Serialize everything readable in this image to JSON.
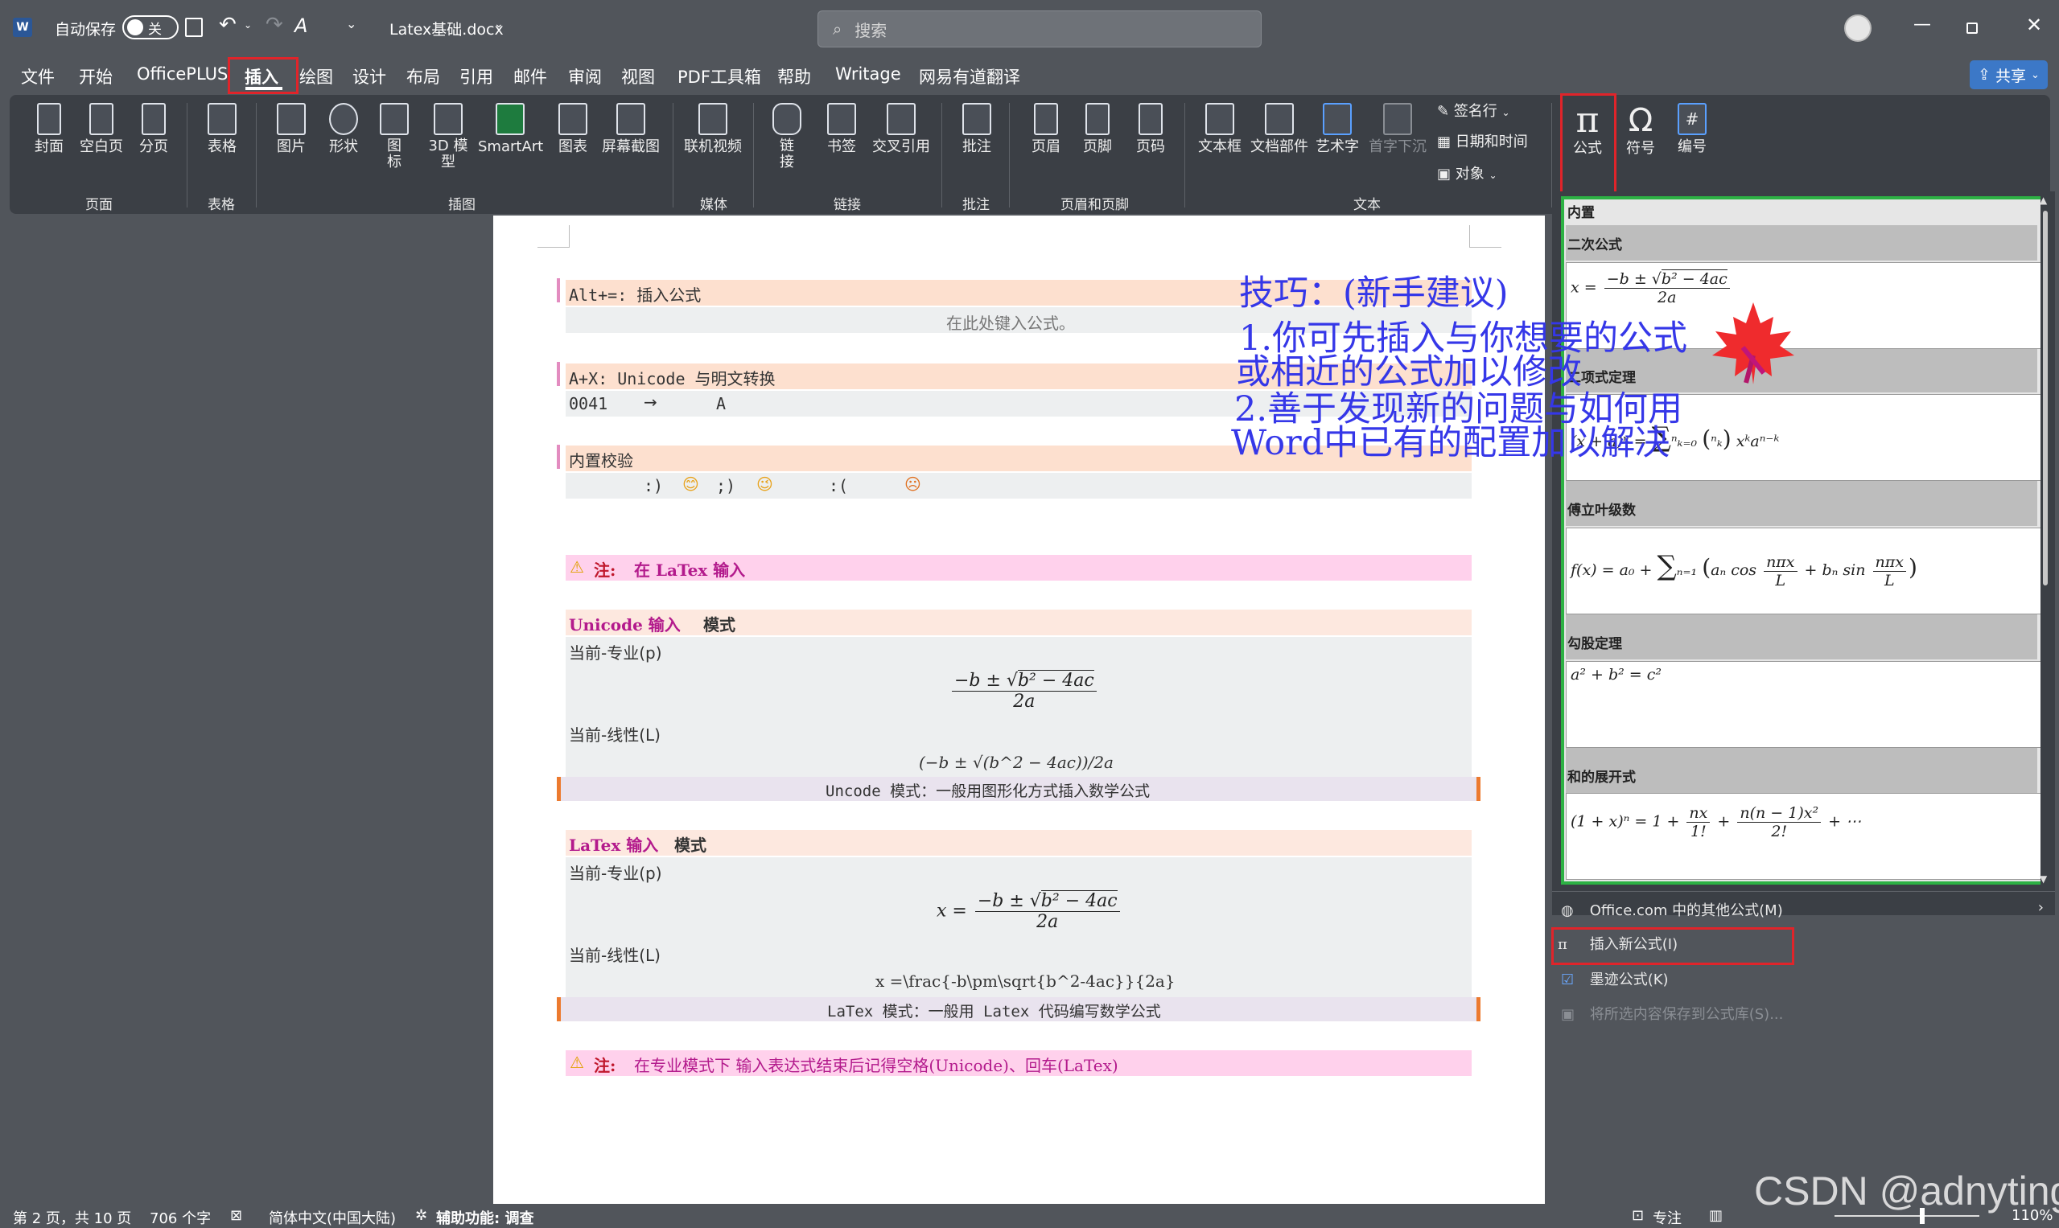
{
  "titlebar": {
    "autosave_label": "自动保存",
    "autosave_state": "关",
    "doc_title": "Latex基础.docx",
    "search_placeholder": "搜索"
  },
  "menu": {
    "tabs": [
      "文件",
      "开始",
      "OfficePLUS",
      "插入",
      "绘图",
      "设计",
      "布局",
      "引用",
      "邮件",
      "审阅",
      "视图",
      "PDF工具箱",
      "帮助",
      "Writage",
      "网易有道翻译"
    ],
    "active": "插入",
    "share_label": "共享"
  },
  "ribbon": {
    "buttons": {
      "cover": "封面",
      "blank": "空白页",
      "pagebreak": "分页",
      "table": "表格",
      "picture": "图片",
      "shape": "形状",
      "icon": "图\n标",
      "model3d": "3D 模\n型",
      "smartart": "SmartArt",
      "chart": "图表",
      "screenshot": "屏幕截图",
      "video": "联机视频",
      "link": "链\n接",
      "bookmark": "书签",
      "crossref": "交叉引用",
      "comment": "批注",
      "header": "页眉",
      "footer": "页脚",
      "pagenum": "页码",
      "textbox": "文本框",
      "docparts": "文档部件",
      "wordart": "艺术字",
      "dropcap": "首字下沉",
      "signature": "签名行",
      "datetime": "日期和时间",
      "object": "对象",
      "formula": "公式",
      "symbol": "符号",
      "number": "编号"
    },
    "groups": [
      "页面",
      "表格",
      "插图",
      "媒体",
      "链接",
      "批注",
      "页眉和页脚",
      "文本"
    ]
  },
  "document": {
    "s1_title": "Alt+=: 插入公式",
    "s1_placeholder": "在此处键入公式。",
    "s2_title": "A+X: Unicode 与明文转换",
    "s2_code": "0041",
    "s2_arrow": "→",
    "s2_char": "A",
    "s3_title": "内置校验",
    "s3_a": ":)",
    "s3_b": ";)",
    "s3_c": ":(",
    "emoji_smile": "😊",
    "emoji_wink": "😉",
    "emoji_sad": "☹",
    "note1_icon": "⚠",
    "note1_label": "注:",
    "note1_text": "在 LaTex 输入",
    "uni_head_a": "Unicode 输入",
    "uni_head_b": "模式",
    "pro_mode": "当前-专业(p)",
    "lin_mode": "当前-线性(L)",
    "uni_formula_lin": "(−b ± √(b^2 − 4ac))/2a",
    "uni_caption": "Uncode 模式：一般用图形化方式插入数学公式",
    "latex_head_a": "LaTex 输入",
    "latex_head_b": "模式",
    "latex_formula_lin": "x =\\frac{-b\\pm\\sqrt{b^2-4ac}}{2a}",
    "latex_caption": "LaTex 模式：一般用 Latex 代码编写数学公式",
    "note2_icon": "⚠",
    "note2_label": "注:",
    "note2_text": "在专业模式下 输入表达式结束后记得空格(Unicode)、回车(LaTex)"
  },
  "annotation": {
    "line1": "技巧：(新手建议)",
    "line2": "1.你可先插入与你想要的公式",
    "line3": "或相近的公式加以修改",
    "line4": "2.善于发现新的问题与如何用",
    "line5": "Word中已有的配置加以解决"
  },
  "gallery": {
    "header": "内置",
    "items": [
      "二次公式",
      "二项式定理",
      "傅立叶级数",
      "勾股定理",
      "和的展开式"
    ],
    "menu": [
      "Office.com 中的其他公式(M)",
      "插入新公式(I)",
      "墨迹公式(K)",
      "将所选内容保存到公式库(S)..."
    ]
  },
  "status": {
    "page": "第 2 页，共 10 页",
    "words": "706 个字",
    "lang": "简体中文(中国大陆)",
    "access": "辅助功能: 调查",
    "focus": "专注",
    "zoom": "110%"
  },
  "watermark": "CSDN @adnyting",
  "colors": {
    "accent_red": "#e0242a",
    "gallery_green": "#2db144",
    "handwriting_blue": "#3537e8"
  }
}
